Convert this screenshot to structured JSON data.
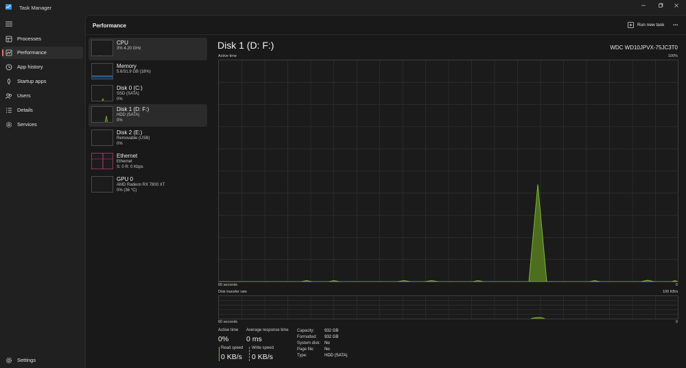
{
  "window": {
    "title": "Task Manager",
    "controls": [
      "minimize",
      "maximize",
      "close"
    ]
  },
  "nav": {
    "items": [
      {
        "label": "Processes",
        "icon": "processes-icon",
        "active": false
      },
      {
        "label": "Performance",
        "icon": "performance-icon",
        "active": true
      },
      {
        "label": "App history",
        "icon": "app-history-icon",
        "active": false
      },
      {
        "label": "Startup apps",
        "icon": "startup-apps-icon",
        "active": false
      },
      {
        "label": "Users",
        "icon": "users-icon",
        "active": false
      },
      {
        "label": "Details",
        "icon": "details-icon",
        "active": false
      },
      {
        "label": "Services",
        "icon": "services-icon",
        "active": false
      }
    ],
    "settings_label": "Settings"
  },
  "header": {
    "title": "Performance",
    "run_new_task": "Run new task",
    "more": "..."
  },
  "devices": [
    {
      "name": "CPU",
      "sub1": "3%  4.20 GHz",
      "sub2": ""
    },
    {
      "name": "Memory",
      "sub1": "5.6/31.9 GB (18%)",
      "sub2": ""
    },
    {
      "name": "Disk 0 (C:)",
      "sub1": "SSD (SATA)",
      "sub2": "0%"
    },
    {
      "name": "Disk 1 (D: F:)",
      "sub1": "HDD (SATA)",
      "sub2": "0%"
    },
    {
      "name": "Disk 2 (E:)",
      "sub1": "Removable (USB)",
      "sub2": "0%"
    },
    {
      "name": "Ethernet",
      "sub1": "Ethernet",
      "sub2": "S: 0  R: 0 Kbps"
    },
    {
      "name": "GPU 0",
      "sub1": "AMD Radeon RX 7800 XT",
      "sub2": "0%  (36 °C)"
    }
  ],
  "detail": {
    "title": "Disk 1 (D: F:)",
    "model": "WDC WD10JPVX-75JC3T0",
    "active_graph": {
      "label": "Active time",
      "max_label": "100%",
      "time_label": "60 seconds",
      "min_label": "0"
    },
    "transfer_graph": {
      "label": "Disk transfer rate",
      "max_label": "100 KB/s",
      "time_label": "60 seconds",
      "min_label": "0"
    },
    "stats": {
      "active_time_label": "Active time",
      "active_time_value": "0%",
      "avg_response_label": "Average response time",
      "avg_response_value": "0 ms",
      "read_speed_label": "Read speed",
      "read_speed_value": "0 KB/s",
      "write_speed_label": "Write speed",
      "write_speed_value": "0 KB/s"
    },
    "properties": [
      {
        "label": "Capacity:",
        "value": "932 GB"
      },
      {
        "label": "Formatted:",
        "value": "932 GB"
      },
      {
        "label": "System disk:",
        "value": "No"
      },
      {
        "label": "Page file:",
        "value": "No"
      },
      {
        "label": "Type:",
        "value": "HDD (SATA)"
      }
    ]
  },
  "colors": {
    "accent_disk": "#7eb835",
    "accent_memory": "#3a8fd9",
    "accent_ethernet": "#d1347a",
    "nav_indicator": "#e4786a"
  }
}
